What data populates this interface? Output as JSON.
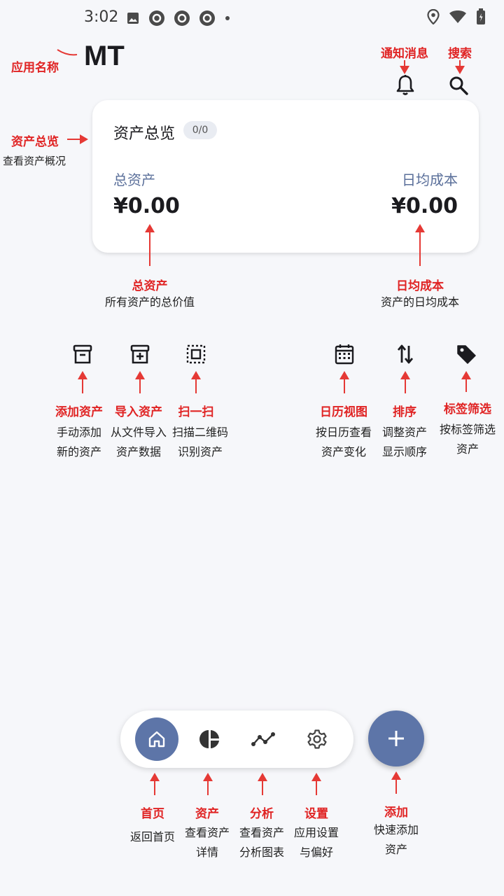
{
  "status_bar": {
    "time": "3:02"
  },
  "app": {
    "name": "MT"
  },
  "annotations": {
    "app_name": {
      "title": "应用名称"
    },
    "notifications": {
      "title": "通知消息"
    },
    "search": {
      "title": "搜索"
    },
    "overview": {
      "title": "资产总览",
      "desc": "查看资产概况"
    },
    "total_assets": {
      "title": "总资产",
      "desc": "所有资产的总价值"
    },
    "daily_cost": {
      "title": "日均成本",
      "desc": "资产的日均成本"
    },
    "add_asset": {
      "title": "添加资产",
      "desc1": "手动添加",
      "desc2": "新的资产"
    },
    "import_asset": {
      "title": "导入资产",
      "desc1": "从文件导入",
      "desc2": "资产数据"
    },
    "scan": {
      "title": "扫一扫",
      "desc1": "扫描二维码",
      "desc2": "识别资产"
    },
    "calendar": {
      "title": "日历视图",
      "desc1": "按日历查看",
      "desc2": "资产变化"
    },
    "sort": {
      "title": "排序",
      "desc1": "调整资产",
      "desc2": "显示顺序"
    },
    "tag_filter": {
      "title": "标签筛选",
      "desc1": "按标签筛选",
      "desc2": "资产"
    },
    "nav_home": {
      "title": "首页",
      "desc1": "返回首页"
    },
    "nav_assets": {
      "title": "资产",
      "desc1": "查看资产",
      "desc2": "详情"
    },
    "nav_analysis": {
      "title": "分析",
      "desc1": "查看资产",
      "desc2": "分析图表"
    },
    "nav_settings": {
      "title": "设置",
      "desc1": "应用设置",
      "desc2": "与偏好"
    },
    "fab_add": {
      "title": "添加",
      "desc1": "快速添加",
      "desc2": "资产"
    }
  },
  "overview_card": {
    "title": "资产总览",
    "badge": "0/0",
    "total_label": "总资产",
    "total_value": "¥0.00",
    "daily_label": "日均成本",
    "daily_value": "¥0.00"
  },
  "icons": {
    "header": [
      "bell-icon",
      "search-icon"
    ],
    "actions": [
      "archive-icon",
      "import-box-icon",
      "scan-icon",
      "calendar-icon",
      "sort-icon",
      "tag-icon"
    ],
    "nav": [
      "home-icon",
      "pie-chart-icon",
      "line-chart-icon",
      "gear-icon"
    ],
    "fab": "plus-icon"
  },
  "colors": {
    "accent": "#5d75a8",
    "annotation": "#e02424",
    "label_blue": "#5a6f9a",
    "background": "#f6f7fa"
  }
}
